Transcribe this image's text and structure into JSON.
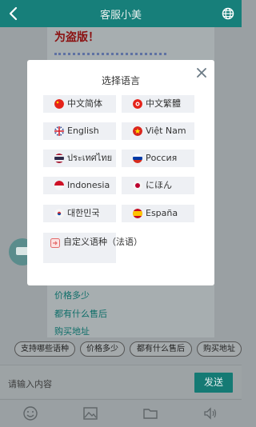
{
  "header": {
    "title": "客服小美"
  },
  "chat": {
    "warning": "为盗版！",
    "faq_links": [
      "价格多少",
      "都有什么售后",
      "购买地址"
    ]
  },
  "quick_replies": [
    "支持哪些语种",
    "价格多少",
    "都有什么售后",
    "购买地址"
  ],
  "input": {
    "placeholder": "请输入内容",
    "send_label": "发送"
  },
  "modal": {
    "title": "选择语言",
    "languages": [
      {
        "label": "中文简体",
        "flag": "china-flag"
      },
      {
        "label": "中文繁體",
        "flag": "hongkong-flag"
      },
      {
        "label": "English",
        "flag": "uk-flag"
      },
      {
        "label": "Việt Nam",
        "flag": "vietnam-flag"
      },
      {
        "label": "ประเทศไทย",
        "flag": "thailand-flag"
      },
      {
        "label": "Россия",
        "flag": "russia-flag"
      },
      {
        "label": "Indonesia",
        "flag": "indonesia-flag"
      },
      {
        "label": "にほん",
        "flag": "japan-flag"
      },
      {
        "label": "대한민국",
        "flag": "korea-flag"
      },
      {
        "label": "España",
        "flag": "spain-flag"
      }
    ],
    "custom_label": "自定义语种（法语）"
  },
  "colors": {
    "brand": "#177f7a",
    "send": "#157a74",
    "warning": "#8b1010"
  }
}
